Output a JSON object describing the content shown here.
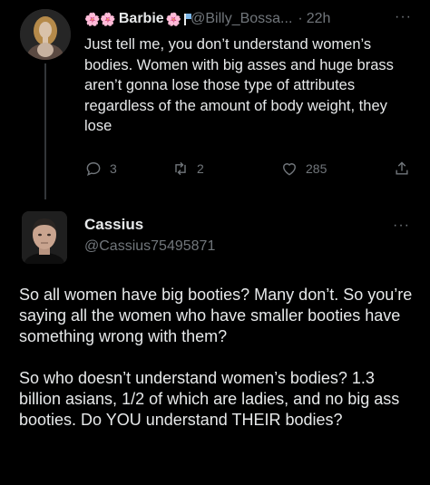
{
  "tweet1": {
    "display_name": "Barbie",
    "name_prefix_emoji": "🌸🌸",
    "name_suffix_emoji": "🌸",
    "handle": "@Billy_Bossa...",
    "separator": "·",
    "time": "22h",
    "more": "···",
    "text": "Just tell me, you don’t understand women’s bodies. Women with big asses and huge brass aren’t gonna lose those type of attributes regardless of the amount of body weight, they lose",
    "actions": {
      "replies": "3",
      "reposts": "2",
      "likes": "285"
    }
  },
  "tweet2": {
    "display_name": "Cassius",
    "handle": "@Cassius75495871",
    "more": "···",
    "paragraphs": [
      "So all women have big booties? Many don’t. So you’re saying all the women who have smaller booties have something wrong with them?",
      "So who doesn’t understand women’s bodies? 1.3 billion asians, 1/2 of which are ladies, and no big ass booties. Do YOU understand THEIR bodies?"
    ]
  },
  "colors": {
    "background": "#000000",
    "text": "#e7e9ea",
    "secondary": "#71767b",
    "thread_line": "#333639"
  },
  "icons": {
    "reply": "reply-icon",
    "repost": "repost-icon",
    "like": "heart-icon",
    "share": "share-icon"
  }
}
